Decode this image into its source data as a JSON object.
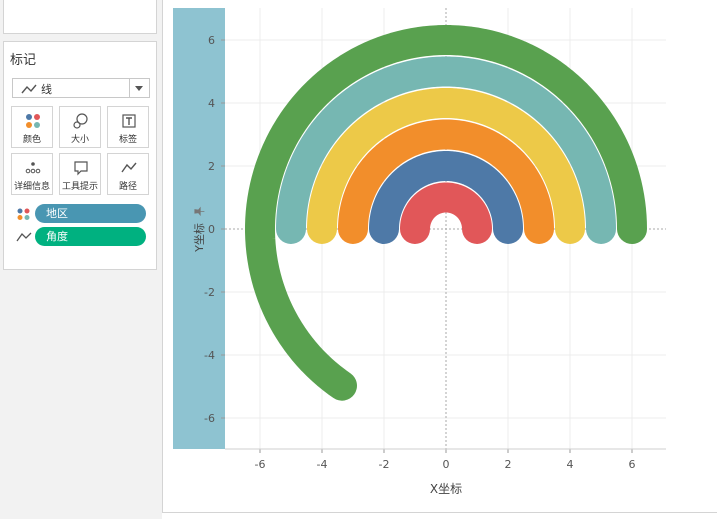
{
  "marks_card": {
    "title": "标记",
    "mark_type": "线",
    "buttons": [
      {
        "id": "color",
        "label": "颜色",
        "icon": "color-dots-icon"
      },
      {
        "id": "size",
        "label": "大小",
        "icon": "size-circles-icon"
      },
      {
        "id": "label",
        "label": "标签",
        "icon": "label-text-icon"
      },
      {
        "id": "detail",
        "label": "详细信息",
        "icon": "detail-dots-icon"
      },
      {
        "id": "tooltip",
        "label": "工具提示",
        "icon": "tooltip-bubble-icon"
      },
      {
        "id": "path",
        "label": "路径",
        "icon": "path-line-icon"
      }
    ],
    "pills": [
      {
        "label": "地区",
        "role": "color",
        "color": "#4996b2"
      },
      {
        "label": "角度",
        "role": "path",
        "color": "#00b180"
      }
    ]
  },
  "chart": {
    "x_axis_title": "X坐标",
    "y_axis_title": "Y坐标",
    "pin_icon": "pin-icon",
    "y_shelf_color": "#8ec3d1"
  },
  "chart_data": {
    "type": "line",
    "xlabel": "X坐标",
    "ylabel": "Y坐标",
    "xlim": [
      -7,
      7
    ],
    "ylim": [
      -7,
      7
    ],
    "x_ticks": [
      -6,
      -4,
      -2,
      0,
      2,
      4,
      6
    ],
    "y_ticks": [
      6,
      4,
      2,
      0,
      -2,
      -4,
      -6
    ],
    "grid": true,
    "series": [
      {
        "radius": 1,
        "start_angle": 0,
        "sweep": 180,
        "color": "#e15759",
        "stroke": 30
      },
      {
        "radius": 2,
        "start_angle": 0,
        "sweep": 180,
        "color": "#4e79a7",
        "stroke": 30
      },
      {
        "radius": 3,
        "start_angle": 0,
        "sweep": 180,
        "color": "#f28e2b",
        "stroke": 30
      },
      {
        "radius": 4,
        "start_angle": 0,
        "sweep": 180,
        "color": "#edc948",
        "stroke": 30
      },
      {
        "radius": 5,
        "start_angle": 0,
        "sweep": 180,
        "color": "#76b7b2",
        "stroke": 30
      },
      {
        "radius": 6,
        "start_angle": 0,
        "sweep": 236,
        "color": "#59a14f",
        "stroke": 30
      }
    ]
  }
}
